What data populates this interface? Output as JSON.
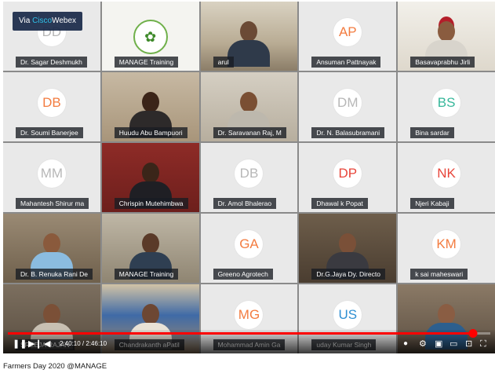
{
  "webex_badge": {
    "prefix": "Via ",
    "brand": "Cisco",
    "product": "Webex"
  },
  "tiles": [
    {
      "type": "initials",
      "initials": "DD",
      "color": "gray",
      "name": "Dr. Sagar Deshmukh"
    },
    {
      "type": "logo",
      "name": "MANAGE Training"
    },
    {
      "type": "video",
      "scene": "arul",
      "name": "arul"
    },
    {
      "type": "initials",
      "initials": "AP",
      "color": "orange",
      "name": "Ansuman Pattnayak"
    },
    {
      "type": "video",
      "scene": "basava",
      "name": "Basavaprabhu Jirli"
    },
    {
      "type": "initials",
      "initials": "DB",
      "color": "orange",
      "name": "Dr. Soumi Banerjee"
    },
    {
      "type": "video",
      "scene": "huudu",
      "name": "Huudu Abu Bampuori"
    },
    {
      "type": "video",
      "scene": "saravanan",
      "name": "Dr. Saravanan Raj, M"
    },
    {
      "type": "initials",
      "initials": "DM",
      "color": "gray",
      "name": "Dr. N. Balasubramani"
    },
    {
      "type": "initials",
      "initials": "BS",
      "color": "teal",
      "name": "Bina sardar"
    },
    {
      "type": "initials",
      "initials": "MM",
      "color": "gray",
      "name": "Mahantesh Shirur ma"
    },
    {
      "type": "video",
      "scene": "chrispin",
      "name": "Chrispin Mutehimbwa"
    },
    {
      "type": "initials",
      "initials": "DB",
      "color": "gray",
      "name": "Dr. Amol Bhalerao"
    },
    {
      "type": "initials",
      "initials": "DP",
      "color": "red",
      "name": "Dhawal k Popat"
    },
    {
      "type": "initials",
      "initials": "NK",
      "color": "red",
      "name": "Njeri Kabaji"
    },
    {
      "type": "video",
      "scene": "renuka",
      "name": "Dr. B. Renuka Rani De"
    },
    {
      "type": "video",
      "scene": "headset",
      "name": "MANAGE Training"
    },
    {
      "type": "initials",
      "initials": "GA",
      "color": "orange",
      "name": "Greeno Agrotech"
    },
    {
      "type": "video",
      "scene": "jaya",
      "name": "Dr.G.Jaya Dy. Directo"
    },
    {
      "type": "initials",
      "initials": "KM",
      "color": "orange",
      "name": "k sai maheswari"
    },
    {
      "type": "video",
      "scene": "room",
      "name": "SREEJA RAJAN"
    },
    {
      "type": "video",
      "scene": "banner",
      "name": "Chandrakanth aPatil"
    },
    {
      "type": "initials",
      "initials": "MG",
      "color": "orange",
      "name": "Mohammad Amin Ga"
    },
    {
      "type": "initials",
      "initials": "US",
      "color": "blue",
      "name": "uday Kumar Singh"
    },
    {
      "type": "video",
      "scene": "specs",
      "name": ""
    }
  ],
  "player": {
    "current_time": "2:40:10",
    "separator": " / ",
    "duration": "2:46:10",
    "progress": 0.964
  },
  "caption": "Farmers Day 2020 @MANAGE",
  "colors": {
    "progress": "#ff0000"
  }
}
